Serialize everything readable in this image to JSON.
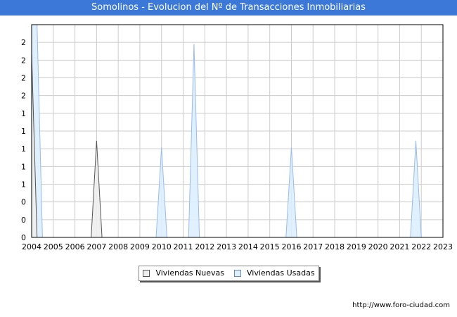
{
  "header": {
    "title": "Somolinos - Evolucion del Nº de Transacciones Inmobiliarias"
  },
  "footer": {
    "url": "http://www.foro-ciudad.com"
  },
  "colors": {
    "title_bg": "#3b78d8",
    "nuevas_fill": "#eeeeee",
    "nuevas_stroke": "#555555",
    "usadas_fill": "#ddeeff",
    "usadas_stroke": "#99bbee",
    "grid": "#cccccc"
  },
  "chart_data": {
    "type": "area",
    "title": "Somolinos - Evolucion del Nº de Transacciones Inmobiliarias",
    "xlabel": "",
    "ylabel": "",
    "x_ticks": [
      "2004",
      "2005",
      "2006",
      "2007",
      "2008",
      "2009",
      "2010",
      "2011",
      "2012",
      "2013",
      "2014",
      "2015",
      "2016",
      "2017",
      "2018",
      "2019",
      "2020",
      "2021",
      "2022",
      "2023"
    ],
    "y_ticks": [
      "0",
      "0",
      "0",
      "1",
      "1",
      "1",
      "1",
      "1",
      "2",
      "2",
      "2",
      "2"
    ],
    "xlim": [
      2004,
      2023
    ],
    "ylim": [
      0,
      2.2
    ],
    "grid": true,
    "legend_position": "bottom",
    "series": [
      {
        "name": "Viviendas Nuevas",
        "points": [
          [
            2004.0,
            1.9
          ],
          [
            2004.25,
            0
          ],
          [
            2006.75,
            0
          ],
          [
            2007.0,
            1.0
          ],
          [
            2007.25,
            0
          ]
        ]
      },
      {
        "name": "Viviendas Usadas",
        "points": [
          [
            2004.0,
            2.2
          ],
          [
            2004.25,
            2.2
          ],
          [
            2004.5,
            0
          ],
          [
            2009.75,
            0
          ],
          [
            2010.0,
            0.93
          ],
          [
            2010.25,
            0
          ],
          [
            2011.25,
            0
          ],
          [
            2011.5,
            2.0
          ],
          [
            2011.75,
            0
          ],
          [
            2015.75,
            0
          ],
          [
            2016.0,
            0.93
          ],
          [
            2016.25,
            0
          ],
          [
            2021.5,
            0
          ],
          [
            2021.75,
            1.0
          ],
          [
            2022.0,
            0
          ]
        ]
      }
    ]
  }
}
